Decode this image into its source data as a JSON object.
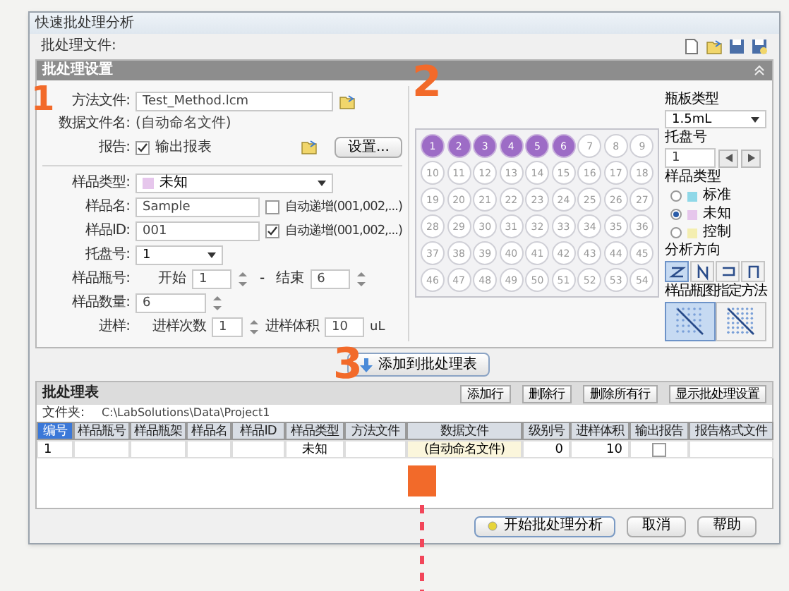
{
  "window": {
    "title": "快速批处理分析"
  },
  "toolbar": {
    "label": "批处理文件:"
  },
  "settings": {
    "title": "批处理设置",
    "method_file": {
      "label": "方法文件:",
      "value": "Test_Method.lcm"
    },
    "data_file": {
      "label": "数据文件名:",
      "value": "(自动命名文件)"
    },
    "report": {
      "label": "报告:",
      "checkbox": "输出报表",
      "checked": true,
      "button": "设置..."
    },
    "sample_type": {
      "label": "样品类型:",
      "value": "未知",
      "color": "#e6c6ec"
    },
    "sample_name": {
      "label": "样品名:",
      "value": "Sample",
      "auto": "自动递增(001,002,...)",
      "checked": false
    },
    "sample_id": {
      "label": "样品ID:",
      "value": "001",
      "auto": "自动递增(001,002,...)",
      "checked": true
    },
    "tray": {
      "label": "托盘号:",
      "value": "1"
    },
    "vial": {
      "label": "样品瓶号:",
      "start_label": "开始",
      "start": "1",
      "dash": "-",
      "end_label": "结束",
      "end": "6"
    },
    "count": {
      "label": "样品数量:",
      "value": "6"
    },
    "injection": {
      "label": "进样:",
      "times_label": "进样次数",
      "times": "1",
      "volume_label": "进样体积",
      "volume": "10",
      "unit": "uL"
    }
  },
  "plate": {
    "wells": [
      {
        "label": "1",
        "selected": true
      },
      {
        "label": "2",
        "selected": true
      },
      {
        "label": "3",
        "selected": true
      },
      {
        "label": "4",
        "selected": true
      },
      {
        "label": "5",
        "selected": true
      },
      {
        "label": "6",
        "selected": true
      },
      {
        "label": "7",
        "selected": false
      },
      {
        "label": "8",
        "selected": false
      },
      {
        "label": "9",
        "selected": false
      },
      {
        "label": "10",
        "selected": false
      },
      {
        "label": "11",
        "selected": false
      },
      {
        "label": "12",
        "selected": false
      },
      {
        "label": "13",
        "selected": false
      },
      {
        "label": "14",
        "selected": false
      },
      {
        "label": "15",
        "selected": false
      },
      {
        "label": "16",
        "selected": false
      },
      {
        "label": "17",
        "selected": false
      },
      {
        "label": "18",
        "selected": false
      },
      {
        "label": "19",
        "selected": false
      },
      {
        "label": "20",
        "selected": false
      },
      {
        "label": "21",
        "selected": false
      },
      {
        "label": "22",
        "selected": false
      },
      {
        "label": "23",
        "selected": false
      },
      {
        "label": "24",
        "selected": false
      },
      {
        "label": "25",
        "selected": false
      },
      {
        "label": "26",
        "selected": false
      },
      {
        "label": "27",
        "selected": false
      },
      {
        "label": "28",
        "selected": false
      },
      {
        "label": "29",
        "selected": false
      },
      {
        "label": "30",
        "selected": false
      },
      {
        "label": "31",
        "selected": false
      },
      {
        "label": "32",
        "selected": false
      },
      {
        "label": "33",
        "selected": false
      },
      {
        "label": "34",
        "selected": false
      },
      {
        "label": "35",
        "selected": false
      },
      {
        "label": "36",
        "selected": false
      },
      {
        "label": "37",
        "selected": false
      },
      {
        "label": "38",
        "selected": false
      },
      {
        "label": "39",
        "selected": false
      },
      {
        "label": "40",
        "selected": false
      },
      {
        "label": "41",
        "selected": false
      },
      {
        "label": "42",
        "selected": false
      },
      {
        "label": "43",
        "selected": false
      },
      {
        "label": "44",
        "selected": false
      },
      {
        "label": "45",
        "selected": false
      },
      {
        "label": "46",
        "selected": false
      },
      {
        "label": "47",
        "selected": false
      },
      {
        "label": "48",
        "selected": false
      },
      {
        "label": "49",
        "selected": false
      },
      {
        "label": "50",
        "selected": false
      },
      {
        "label": "51",
        "selected": false
      },
      {
        "label": "52",
        "selected": false
      },
      {
        "label": "53",
        "selected": false
      },
      {
        "label": "54",
        "selected": false
      }
    ]
  },
  "side": {
    "vial_type": {
      "label": "瓶板类型",
      "value": "1.5mL"
    },
    "tray": {
      "label": "托盘号",
      "value": "1"
    },
    "sample_type": {
      "label": "样品类型",
      "options": [
        {
          "label": "标准",
          "color": "#8fd8e8",
          "selected": false
        },
        {
          "label": "未知",
          "color": "#e6c6ec",
          "selected": true
        },
        {
          "label": "控制",
          "color": "#f4eeb0",
          "selected": false
        }
      ]
    },
    "direction": {
      "label": "分析方向",
      "buttons": [
        {
          "kind": "z-row",
          "selected": true
        },
        {
          "kind": "n-column",
          "selected": false
        },
        {
          "kind": "row-return",
          "selected": false
        },
        {
          "kind": "column-return",
          "selected": false
        }
      ]
    },
    "pattern": {
      "label": "样品瓶图指定方法",
      "buttons": [
        {
          "kind": "grid-large",
          "selected": true
        },
        {
          "kind": "grid-small",
          "selected": false
        }
      ]
    }
  },
  "add_button": "添加到批处理表",
  "batch_table": {
    "title": "批处理表",
    "folder_label": "文件夹:",
    "folder": "C:\\LabSolutions\\Data\\Project1",
    "buttons": [
      "添加行",
      "删除行",
      "删除所有行",
      "显示批处理设置"
    ],
    "columns": [
      {
        "label": "编号",
        "selected": true
      },
      {
        "label": "样品瓶号",
        "selected": false
      },
      {
        "label": "样品瓶架",
        "selected": false
      },
      {
        "label": "样品名",
        "selected": false
      },
      {
        "label": "样品ID",
        "selected": false
      },
      {
        "label": "样品类型",
        "selected": false
      },
      {
        "label": "方法文件",
        "selected": false
      },
      {
        "label": "数据文件",
        "selected": false
      },
      {
        "label": "级别号",
        "selected": false
      },
      {
        "label": "进样体积",
        "selected": false
      },
      {
        "label": "输出报告",
        "selected": false
      },
      {
        "label": "报告格式文件",
        "selected": false
      }
    ],
    "rows": [
      {
        "cells": [
          {
            "kind": "text",
            "text": "1"
          },
          {
            "kind": "empty"
          },
          {
            "kind": "empty"
          },
          {
            "kind": "empty"
          },
          {
            "kind": "empty"
          },
          {
            "kind": "type",
            "text": "未知"
          },
          {
            "kind": "empty"
          },
          {
            "kind": "file",
            "text": "(自动命名文件)"
          },
          {
            "kind": "number",
            "text": "0"
          },
          {
            "kind": "number",
            "text": "10"
          },
          {
            "kind": "check",
            "checked": false
          },
          {
            "kind": "empty"
          }
        ]
      }
    ]
  },
  "footer": {
    "buttons": [
      {
        "label": "开始批处理分析",
        "kind": "primary"
      },
      {
        "label": "取消",
        "kind": "plain"
      },
      {
        "label": "帮助",
        "kind": "plain"
      }
    ]
  },
  "callouts": [
    "1",
    "2",
    "3"
  ]
}
